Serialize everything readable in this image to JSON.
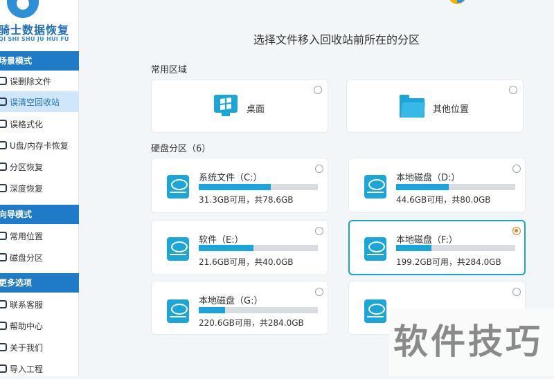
{
  "app": {
    "title": "骑士数据恢复",
    "pinyin": "QI SHI SHU JU HUI FU"
  },
  "sidebar": {
    "sections": [
      {
        "label": "场景模式",
        "items": [
          {
            "label": "误删除文件",
            "active": false
          },
          {
            "label": "误清空回收站",
            "active": true
          },
          {
            "label": "误格式化",
            "active": false
          },
          {
            "label": "U盘/内存卡恢复",
            "active": false
          },
          {
            "label": "分区恢复",
            "active": false
          },
          {
            "label": "深度恢复",
            "active": false
          }
        ]
      },
      {
        "label": "向导模式",
        "items": [
          {
            "label": "常用位置",
            "active": false
          },
          {
            "label": "磁盘分区",
            "active": false
          }
        ]
      },
      {
        "label": "更多选项",
        "items": [
          {
            "label": "联系客服",
            "active": false
          },
          {
            "label": "帮助中心",
            "active": false
          },
          {
            "label": "关于我们",
            "active": false
          },
          {
            "label": "导入工程",
            "active": false
          }
        ]
      }
    ]
  },
  "main": {
    "title": "选择文件移入回收站前所在的分区",
    "common_area": {
      "label": "常用区域",
      "items": [
        {
          "name": "桌面",
          "icon": "windows-desktop-icon",
          "selected": false
        },
        {
          "name": "其他位置",
          "icon": "folder-icon",
          "selected": false
        }
      ]
    },
    "disk_area": {
      "label": "硬盘分区（6）",
      "partitions": [
        {
          "name": "系统文件（C:）",
          "caption": "31.3GB可用，共78.6GB",
          "used_fraction": 0.602,
          "selected": false
        },
        {
          "name": "本地磁盘（D:）",
          "caption": "44.6GB可用，共80.0GB",
          "used_fraction": 0.443,
          "selected": false
        },
        {
          "name": "软件（E:）",
          "caption": "21.6GB可用，共40.0GB",
          "used_fraction": 0.46,
          "selected": false
        },
        {
          "name": "本地磁盘（F:）",
          "caption": "199.2GB可用，共284.0GB",
          "used_fraction": 0.299,
          "selected": true
        },
        {
          "name": "本地磁盘（G:）",
          "caption": "220.6GB可用，共284.0GB",
          "used_fraction": 0.223,
          "selected": false
        },
        {
          "name": "",
          "caption": "",
          "used_fraction": null,
          "selected": false
        }
      ]
    }
  },
  "watermark": "软件技巧",
  "colors": {
    "accent": "#1ba3dc",
    "sidebar_header": "#1f7bc7",
    "active_item_bg": "#cfe7f8",
    "radio_selected": "#e8821e",
    "selected_border": "#1aa6c8"
  }
}
